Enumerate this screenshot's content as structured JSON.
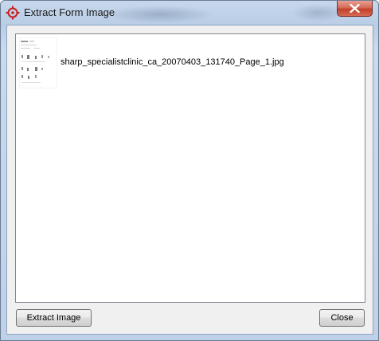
{
  "window": {
    "title": "Extract Form Image",
    "icon": "target-crosshair-icon",
    "close_icon": "close-icon"
  },
  "list": {
    "items": [
      {
        "filename": "sharp_specialistclinic_ca_20070403_131740_Page_1.jpg",
        "thumbnail": "document-page-thumbnail"
      }
    ]
  },
  "buttons": {
    "extract_label": "Extract Image",
    "close_label": "Close"
  },
  "colors": {
    "titlebar": "#bed1e8",
    "client_bg": "#f0f0f0",
    "close_button": "#c2402b",
    "icon_red": "#c8201e"
  }
}
